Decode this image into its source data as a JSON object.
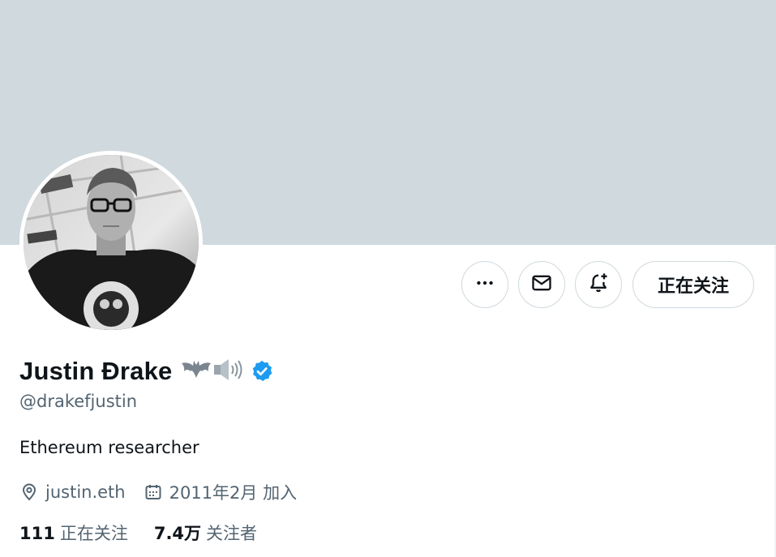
{
  "profile": {
    "display_name": "Justin Ɖrake",
    "handle": "@drakefjustin",
    "bio": "Ethereum researcher",
    "verified": true,
    "name_emojis": [
      "bat",
      "speaker-loud"
    ],
    "website": "justin.eth",
    "join_date": "2011年2月 加入"
  },
  "actions": {
    "more_icon": "more-icon",
    "message_icon": "mail-icon",
    "notify_icon": "bell-plus-icon",
    "follow_label": "正在关注"
  },
  "stats": {
    "following_count": "111",
    "following_label": "正在关注",
    "followers_count": "7.4万",
    "followers_label": "关注者"
  },
  "colors": {
    "banner": "#cfd9de",
    "text_primary": "#0f1419",
    "text_secondary": "#536471",
    "verified_blue": "#1d9bf0",
    "border": "#cfd9de"
  }
}
